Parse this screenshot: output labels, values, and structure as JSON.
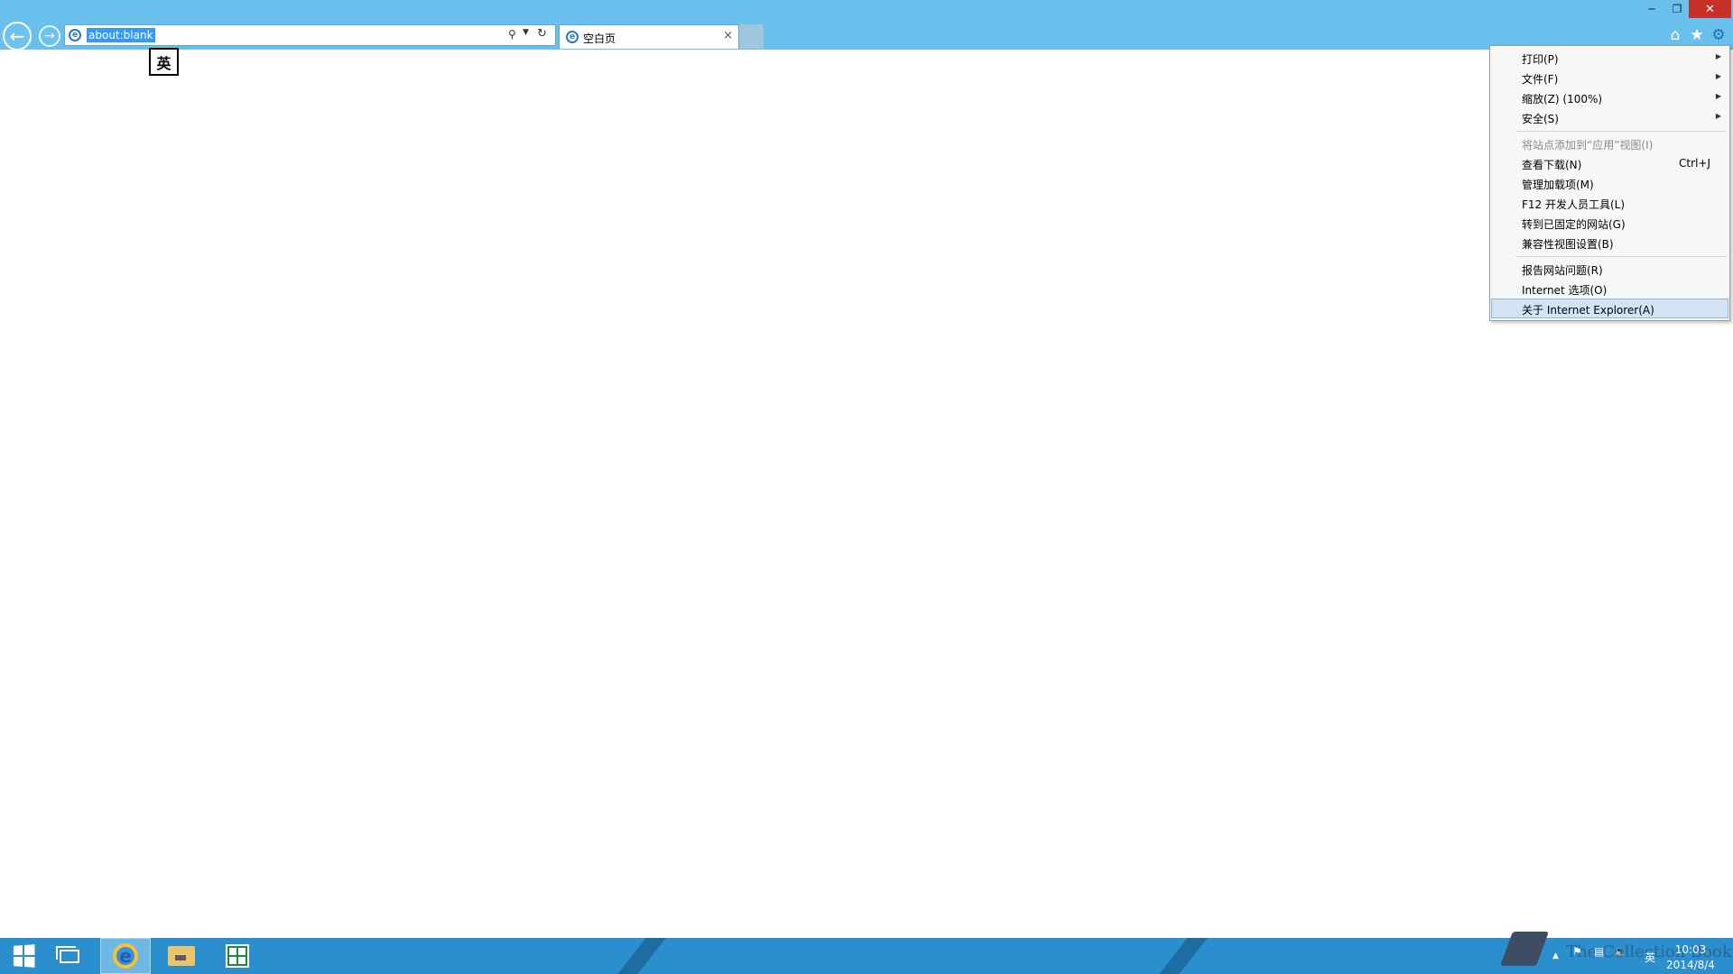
{
  "browser": {
    "address_url": "about:blank",
    "tab_title": "空白页",
    "tab_close": "×"
  },
  "ime_indicator": "英",
  "tools_menu": {
    "items": [
      {
        "label": "打印(P)",
        "submenu": true
      },
      {
        "label": "文件(F)",
        "submenu": true
      },
      {
        "label": "缩放(Z) (100%)",
        "submenu": true
      },
      {
        "label": "安全(S)",
        "submenu": true
      },
      {
        "label": "将站点添加到“应用”视图(I)",
        "disabled": true
      },
      {
        "label": "查看下载(N)",
        "shortcut": "Ctrl+J"
      },
      {
        "label": "管理加载项(M)"
      },
      {
        "label": "F12 开发人员工具(L)"
      },
      {
        "label": "转到已固定的网站(G)"
      },
      {
        "label": "兼容性视图设置(B)"
      },
      {
        "label": "报告网站问题(R)"
      },
      {
        "label": "Internet 选项(O)"
      },
      {
        "label": "关于 Internet Explorer(A)",
        "highlighted": true
      }
    ]
  },
  "watermark": "The Collection Book",
  "taskbar": {
    "tray_ime": "英",
    "clock_time": "10:03",
    "clock_date": "2014/8/4"
  },
  "colors": {
    "titlebar": "#69c0ed",
    "taskbar": "#2b8ecd",
    "url_selection": "#3399ff",
    "menu_highlight": "#d3e5f5",
    "close_button": "#c7312a"
  },
  "icons": [
    "back-arrow-icon",
    "forward-arrow-icon",
    "ie-icon",
    "search-icon",
    "refresh-icon",
    "home-icon",
    "favorites-star-icon",
    "gear-icon",
    "windows-logo-icon",
    "desktop-icon",
    "file-explorer-icon",
    "store-icon",
    "flag-icon",
    "network-icon",
    "volume-icon"
  ]
}
